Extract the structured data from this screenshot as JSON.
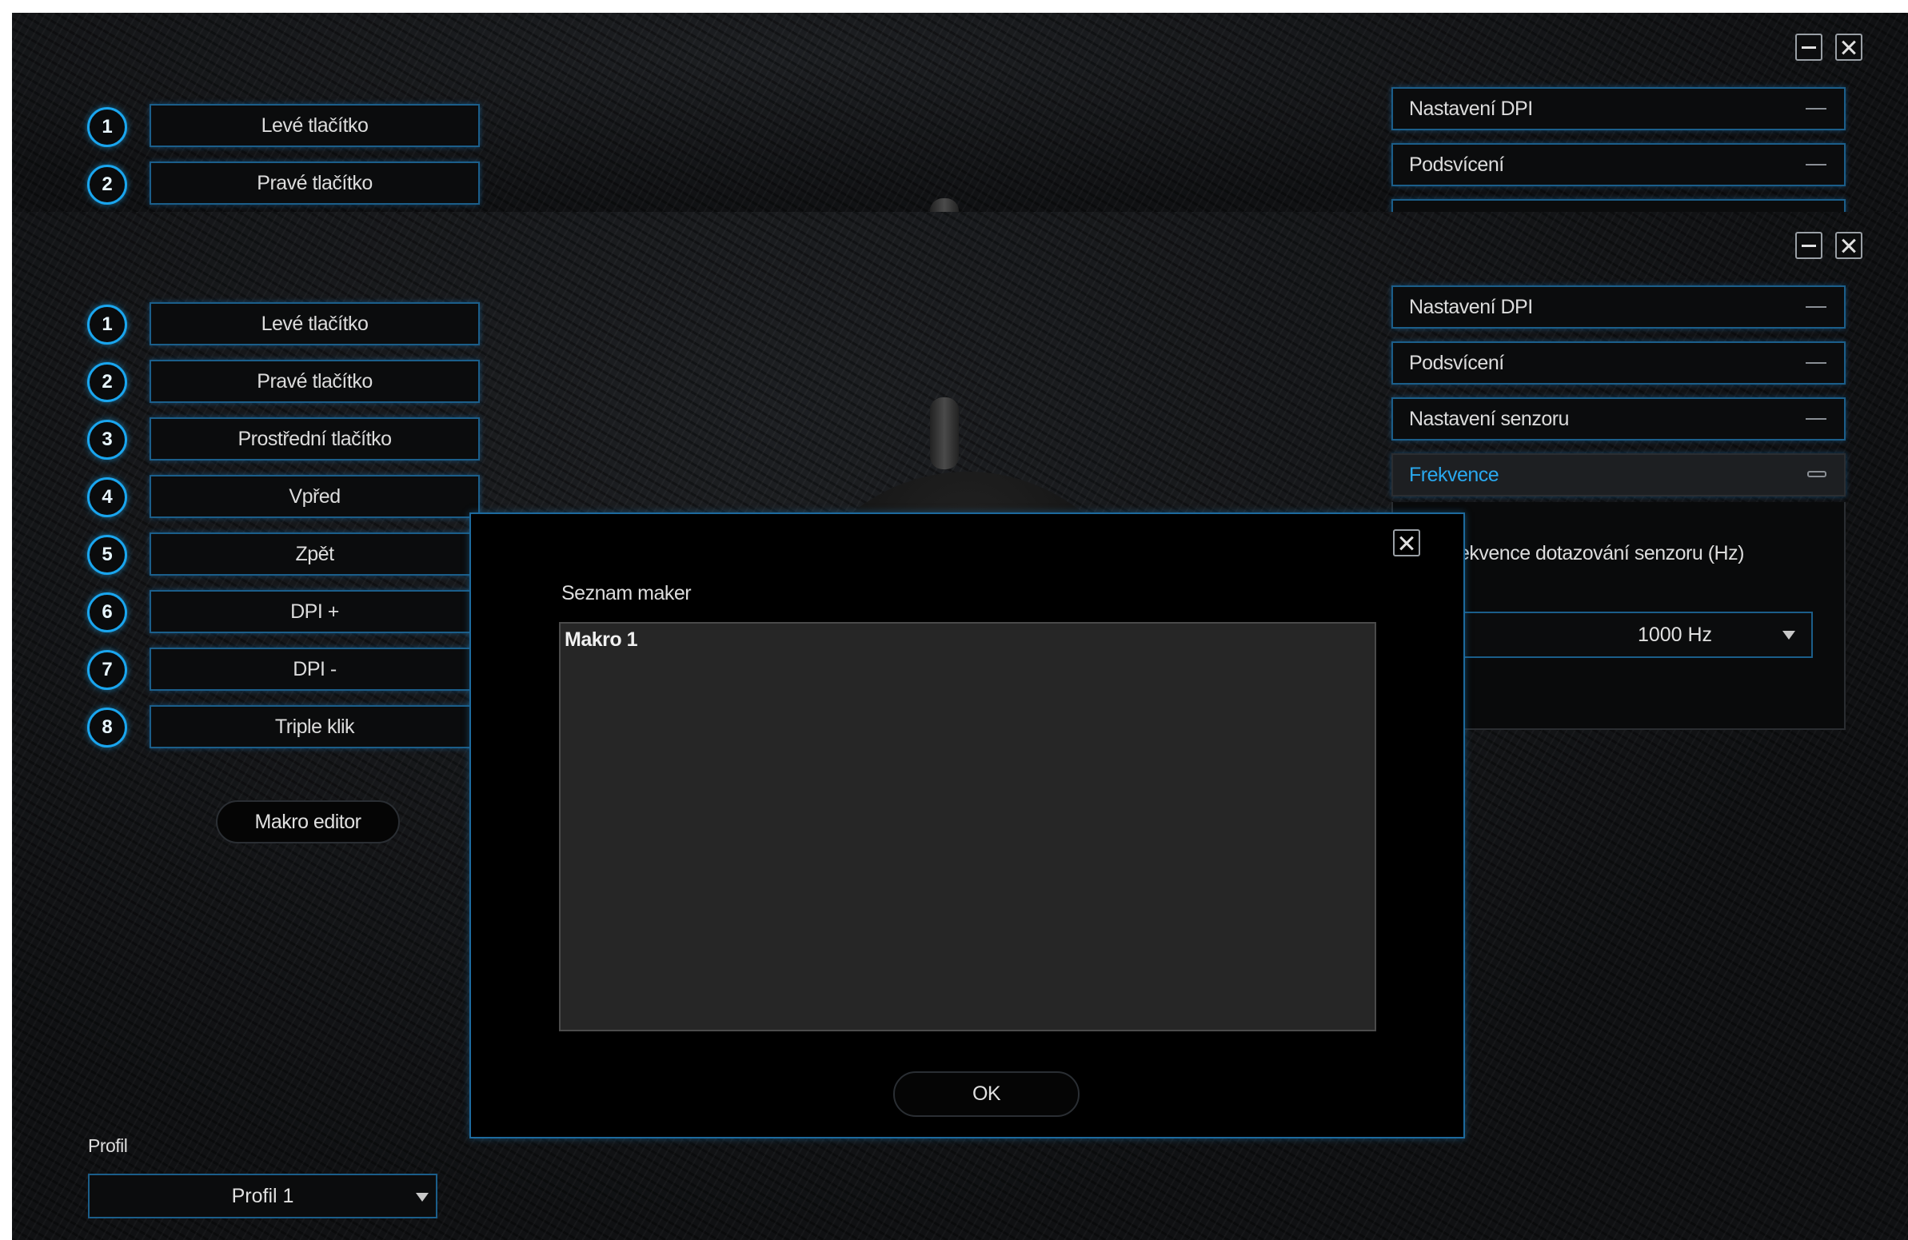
{
  "window_back": {
    "buttons": [
      {
        "num": "1",
        "label": "Levé tlačítko"
      },
      {
        "num": "2",
        "label": "Pravé tlačítko"
      }
    ],
    "accordion": [
      "Nastavení DPI",
      "Podsvícení"
    ]
  },
  "window_front": {
    "buttons": [
      {
        "num": "1",
        "label": "Levé tlačítko"
      },
      {
        "num": "2",
        "label": "Pravé tlačítko"
      },
      {
        "num": "3",
        "label": "Prostřední tlačítko"
      },
      {
        "num": "4",
        "label": "Vpřed"
      },
      {
        "num": "5",
        "label": "Zpět"
      },
      {
        "num": "6",
        "label": "DPI +"
      },
      {
        "num": "7",
        "label": "DPI -"
      },
      {
        "num": "8",
        "label": "Triple klik"
      }
    ],
    "makro_editor_label": "Makro editor",
    "profile": {
      "label": "Profil",
      "value": "Profil 1"
    },
    "accordion": [
      {
        "label": "Nastavení DPI",
        "active": false
      },
      {
        "label": "Podsvícení",
        "active": false
      },
      {
        "label": "Nastavení senzoru",
        "active": false
      },
      {
        "label": "Frekvence",
        "active": true
      }
    ],
    "frequency": {
      "label": "Frekvence dotazování senzoru (Hz)",
      "visible_label": "ekvence dotazování senzoru (Hz)",
      "value": "1000 Hz"
    }
  },
  "dialog": {
    "title": "Seznam maker",
    "items": [
      "Makro 1"
    ],
    "ok_label": "OK"
  },
  "colors": {
    "accent": "#1aa6ef",
    "active_text": "#2aa8ee",
    "background": "#141517"
  }
}
